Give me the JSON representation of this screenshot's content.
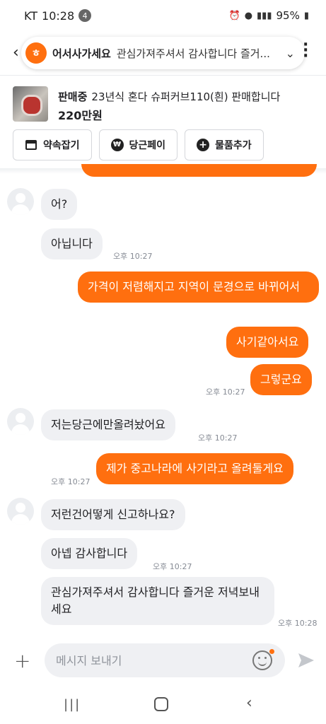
{
  "status_bar": {
    "carrier": "KT",
    "time": "10:28",
    "notification_count": "4",
    "battery": "95%"
  },
  "header": {
    "back_icon": "back-arrow-icon",
    "app_icon_char": "ㅎ",
    "partner_name": "어서사가세요",
    "last_message": "관심가져주셔서 감사합니다 즐거...",
    "expand_icon": "chevron-down-icon",
    "more_icon": "more-vertical-icon"
  },
  "product": {
    "status": "판매중",
    "title": "23년식 혼다 슈퍼커브110(흰) 판매합니다",
    "price": "220만원"
  },
  "actions": [
    {
      "label": "약속잡기",
      "icon": "calendar-icon"
    },
    {
      "label": "당근페이",
      "icon": "karrot-pay-icon"
    },
    {
      "label": "물품추가",
      "icon": "add-circle-icon"
    }
  ],
  "messages": [
    {
      "side": "in",
      "text": "어?"
    },
    {
      "side": "in",
      "text": "아닙니다",
      "time": "오후 10:27"
    },
    {
      "side": "out",
      "text": "가격이 저렴해지고 지역이 문경으로 바뀌어서"
    },
    {
      "side": "out",
      "text": "사기같아서요"
    },
    {
      "side": "out",
      "text": "그렇군요",
      "time": "오후 10:27"
    },
    {
      "side": "in",
      "text": "저는당근에만올려놨어요",
      "time": "오후 10:27"
    },
    {
      "side": "out",
      "text": "제가 중고나라에 사기라고 올려둘게요",
      "time": "오후 10:27"
    },
    {
      "side": "in",
      "text": "저런건어떻게 신고하나요?"
    },
    {
      "side": "in",
      "text": "아넵 감사합니다",
      "time": "오후 10:27"
    },
    {
      "side": "in",
      "text": "관심가져주셔서 감사합니다 즐거운 저녁보내세요",
      "time": "오후 10:28"
    }
  ],
  "composer": {
    "placeholder": "메시지 보내기",
    "value": "",
    "add_icon": "plus-icon",
    "emoji_icon": "emoji-icon",
    "send_icon": "send-icon"
  },
  "colors": {
    "accent": "#ff6f0f",
    "bubble_in": "#eff0f3"
  }
}
